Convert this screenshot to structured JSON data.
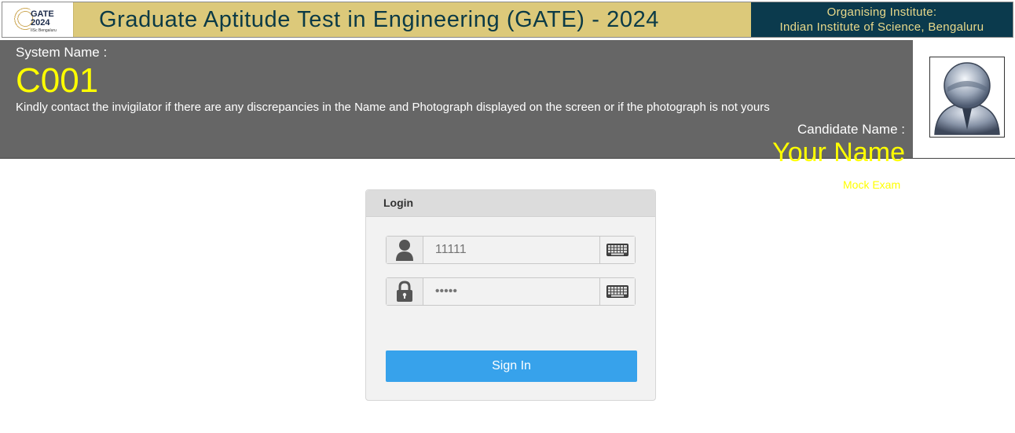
{
  "banner": {
    "logo_line1": "GATE",
    "logo_line2": "2024",
    "logo_line3": "IISc Bengaluru",
    "title": "Graduate Aptitude Test in Engineering (GATE) - 2024",
    "org_label": "Organising Institute:",
    "org_name": "Indian Institute of Science, Bengaluru"
  },
  "info": {
    "system_label": "System Name :",
    "system_value": "C001",
    "notice": "Kindly contact the invigilator if there are any discrepancies in the Name and Photograph displayed on the screen or if the photograph is not yours",
    "candidate_label": "Candidate Name :",
    "candidate_value": "Your Name",
    "exam_label": "Mock Exam"
  },
  "login": {
    "heading": "Login",
    "username_placeholder": "11111",
    "password_placeholder": "•••••",
    "sign_in": "Sign In"
  },
  "icons": [
    "user-icon",
    "lock-icon",
    "keyboard-icon",
    "candidate-photo-icon"
  ],
  "colors": {
    "accent": "#37a2eb",
    "highlight": "#ffff00",
    "infobar": "#666666",
    "banner": "#dcc97a",
    "org_bg": "#0b3a4d"
  }
}
